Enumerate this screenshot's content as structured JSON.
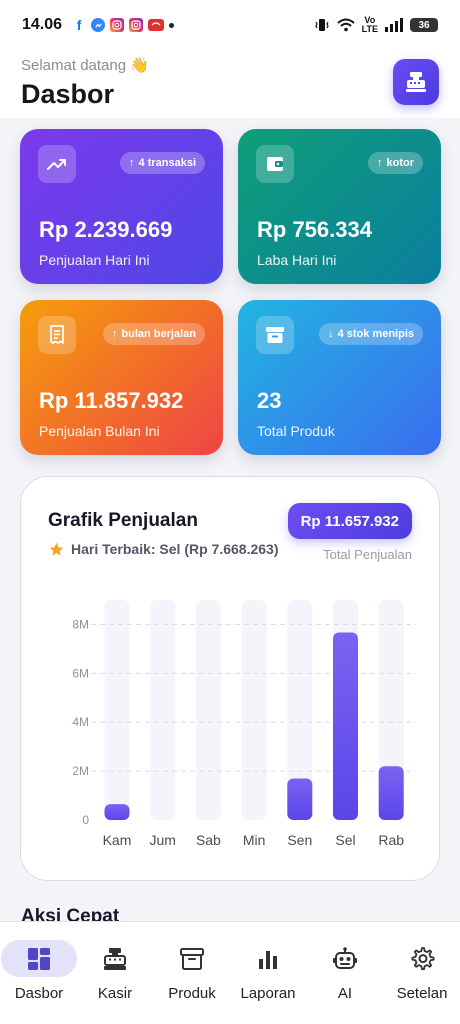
{
  "status_bar": {
    "time": "14.06",
    "notification_icons": [
      "facebook-icon",
      "messenger-icon",
      "instagram-icon",
      "instagram-icon",
      "shopee-icon",
      "dot-icon"
    ],
    "battery": "36",
    "network": "LTE"
  },
  "header": {
    "greeting": "Selamat datang 👋",
    "title": "Dasbor",
    "action_icon": "cash-register-icon"
  },
  "stats": [
    {
      "icon": "trending-up-icon",
      "badge": "4 transaksi",
      "badge_arrow": "↑",
      "value": "Rp 2.239.669",
      "label": "Penjualan Hari Ini"
    },
    {
      "icon": "wallet-icon",
      "badge": "kotor",
      "badge_arrow": "↑",
      "value": "Rp 756.334",
      "label": "Laba Hari Ini"
    },
    {
      "icon": "receipt-icon",
      "badge": "bulan berjalan",
      "badge_arrow": "↑",
      "value": "Rp 11.857.932",
      "label": "Penjualan Bulan Ini"
    },
    {
      "icon": "archive-box-icon",
      "badge": "4 stok menipis",
      "badge_arrow": "↓",
      "value": "23",
      "label": "Total Produk"
    }
  ],
  "chart_panel": {
    "title": "Grafik Penjualan",
    "best_day": "Hari Terbaik: Sel (Rp 7.668.263)",
    "total_value": "Rp 11.657.932",
    "total_caption": "Total Penjualan"
  },
  "chart_data": {
    "type": "bar",
    "title": "Grafik Penjualan",
    "categories": [
      "Kam",
      "Jum",
      "Sab",
      "Min",
      "Sen",
      "Sel",
      "Rab"
    ],
    "values": [
      650000,
      0,
      0,
      0,
      1700000,
      7668263,
      2200000
    ],
    "yticks": [
      "0",
      "2M",
      "4M",
      "6M",
      "8M"
    ],
    "ytick_values": [
      0,
      2000000,
      4000000,
      6000000,
      8000000
    ],
    "ylim": [
      0,
      9000000
    ],
    "grid": true,
    "bar_color": "#5b45e8"
  },
  "quick_actions": {
    "title": "Aksi Cepat"
  },
  "bottom_nav": [
    {
      "label": "Dasbor",
      "icon": "dashboard-grid-icon",
      "active": true
    },
    {
      "label": "Kasir",
      "icon": "cash-register-icon",
      "active": false
    },
    {
      "label": "Produk",
      "icon": "archive-box-icon",
      "active": false
    },
    {
      "label": "Laporan",
      "icon": "bar-chart-icon",
      "active": false
    },
    {
      "label": "AI",
      "icon": "robot-icon",
      "active": false
    },
    {
      "label": "Setelan",
      "icon": "gear-icon",
      "active": false
    }
  ],
  "colors": {
    "accent": "#5b45e8",
    "card_purple": "#6d3ff0",
    "card_green": "#0d8f8c",
    "card_orange": "#f37a25",
    "card_blue": "#2e93e8"
  }
}
